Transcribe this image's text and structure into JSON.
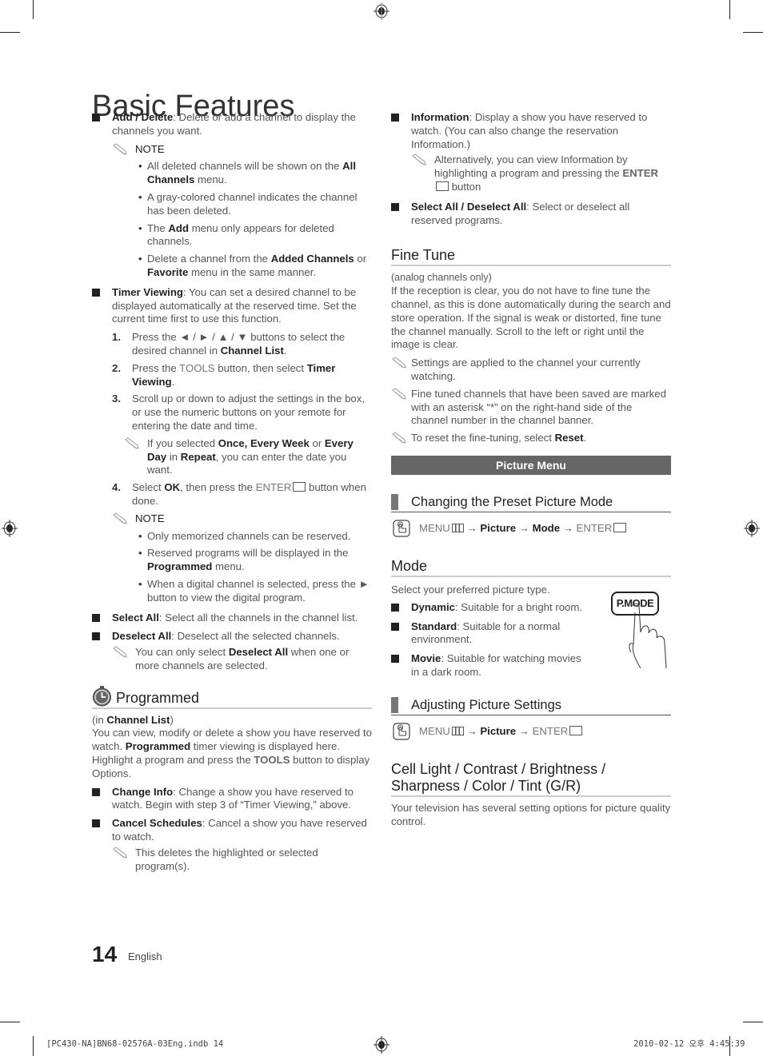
{
  "page": {
    "title": "Basic Features",
    "page_number": "14",
    "language": "English",
    "footer_left": "[PC430-NA]BN68-02576A-03Eng.indb   14",
    "footer_right": "2010-02-12   오후 4:45:39"
  },
  "left": {
    "add_delete": {
      "term": "Add / Delete",
      "text": ": Delete or add a channel to display the channels you want.",
      "note_label": "NOTE",
      "notes": [
        {
          "pre": "All deleted channels will be shown on the ",
          "bold": "All Channels",
          "post": " menu."
        },
        {
          "pre": "A gray-colored channel indicates the channel has been deleted.",
          "bold": "",
          "post": ""
        },
        {
          "pre": "The ",
          "bold": "Add",
          "post": " menu only appears for deleted channels."
        },
        {
          "pre": "Delete a channel from the ",
          "bold": "Added Channels",
          "mid": " or ",
          "bold2": "Favorite",
          "post": " menu in the same manner."
        }
      ]
    },
    "timer_viewing": {
      "term": "Timer Viewing",
      "text": ": You can set a desired channel to be displayed automatically at the reserved time. Set the current time first to use this function.",
      "steps": [
        {
          "n": "1.",
          "pre": "Press the ◄ / ► / ▲ / ▼ buttons to select the desired channel in ",
          "bold": "Channel List",
          "post": "."
        },
        {
          "n": "2.",
          "pre": "Press the ",
          "gray": "TOOLS",
          "mid": " button, then select ",
          "bold": "Timer Viewing",
          "post": "."
        },
        {
          "n": "3.",
          "pre": "Scroll up or down to adjust the settings in the box, or use the numeric buttons on your remote for entering the date and time.",
          "bold": "",
          "post": ""
        },
        {
          "n": "4.",
          "pre": "Select ",
          "bold": "OK",
          "mid": ", then press the ",
          "gray": "ENTER",
          "post": " button when done."
        }
      ],
      "step3_note": {
        "pre": "If you selected ",
        "b1": "Once, Every Week",
        "m1": " or ",
        "b2": "Every Day",
        "m2": " in ",
        "b3": "Repeat",
        "post": ", you can enter the date you want."
      },
      "note_label": "NOTE",
      "notes": [
        {
          "pre": "Only memorized channels can be reserved.",
          "bold": "",
          "post": ""
        },
        {
          "pre": "Reserved programs will be displayed in the ",
          "bold": "Programmed",
          "post": " menu."
        },
        {
          "pre": "When a digital channel is selected, press the ► button to view the digital program.",
          "bold": "",
          "post": ""
        }
      ]
    },
    "select_all": {
      "term": "Select All",
      "text": ": Select all the channels in the channel list."
    },
    "deselect_all": {
      "term": "Deselect All",
      "text": ": Deselect all the selected channels.",
      "note": {
        "pre": "You can only select ",
        "bold": "Deselect All",
        "post": " when one or more channels are selected."
      }
    },
    "programmed": {
      "heading": "Programmed",
      "context_pre": "(in ",
      "context_bold": "Channel List",
      "context_post": ")",
      "desc": {
        "p1": "You can view, modify or delete a show you have reserved to watch. ",
        "b1": "Programmed",
        "p2": " timer viewing is displayed here. Highlight a program and press the ",
        "g1": "TOOLS",
        "p3": " button to display Options."
      },
      "change_info": {
        "term": "Change Info",
        "text": ": Change a show you have reserved to watch. Begin with step 3 of “Timer Viewing,” above."
      },
      "cancel_schedules": {
        "term": "Cancel Schedules",
        "text": ": Cancel a show you have reserved to watch.",
        "note": "This deletes the highlighted or selected program(s)."
      }
    }
  },
  "right": {
    "information": {
      "term": "Information",
      "text": ": Display a show you have reserved to watch. (You can also change the reservation Information.)",
      "note_pre": "Alternatively, you can view Information by highlighting a program and pressing the ",
      "note_gray": "ENTER",
      "note_post": " button"
    },
    "select_deselect_all": {
      "term": "Select All / Deselect All",
      "text": ": Select or deselect all reserved programs."
    },
    "fine_tune": {
      "heading": "Fine Tune",
      "context": "(analog channels only)",
      "desc": "If the reception is clear, you do not have to fine tune the channel, as this is done automatically during the search and store operation. If the signal is weak or distorted, fine tune the channel manually. Scroll to the left or right until the image is clear.",
      "notes": [
        {
          "pre": "Settings are applied to the channel your currently watching.",
          "bold": "",
          "post": ""
        },
        {
          "pre": "Fine tuned channels that have been saved are marked with an asterisk “*” on the right-hand side of the channel number in the channel banner.",
          "bold": "",
          "post": ""
        },
        {
          "pre": "To reset the fine-tuning, select ",
          "bold": "Reset",
          "post": "."
        }
      ]
    },
    "picture_menu": {
      "band": "Picture Menu",
      "preset": {
        "heading": "Changing the Preset Picture Mode",
        "path": {
          "menu": "MENU",
          "arrow": " → ",
          "p1": "Picture",
          "p2": "Mode",
          "enter": "ENTER"
        }
      },
      "mode": {
        "heading": "Mode",
        "intro": "Select your preferred picture type.",
        "items": [
          {
            "term": "Dynamic",
            "text": ": Suitable for a bright room."
          },
          {
            "term": "Standard",
            "text": ": Suitable for a normal environment."
          },
          {
            "term": "Movie",
            "text": ": Suitable for watching movies in a dark room."
          }
        ],
        "button_label": "P.MODE"
      },
      "adjusting": {
        "heading": "Adjusting Picture Settings",
        "path": {
          "menu": "MENU",
          "arrow": " → ",
          "p1": "Picture",
          "enter": "ENTER"
        }
      },
      "cell_light": {
        "heading": "Cell Light / Contrast / Brightness / Sharpness / Color / Tint (G/R)",
        "desc": "Your television has several setting options for picture quality control."
      }
    }
  }
}
